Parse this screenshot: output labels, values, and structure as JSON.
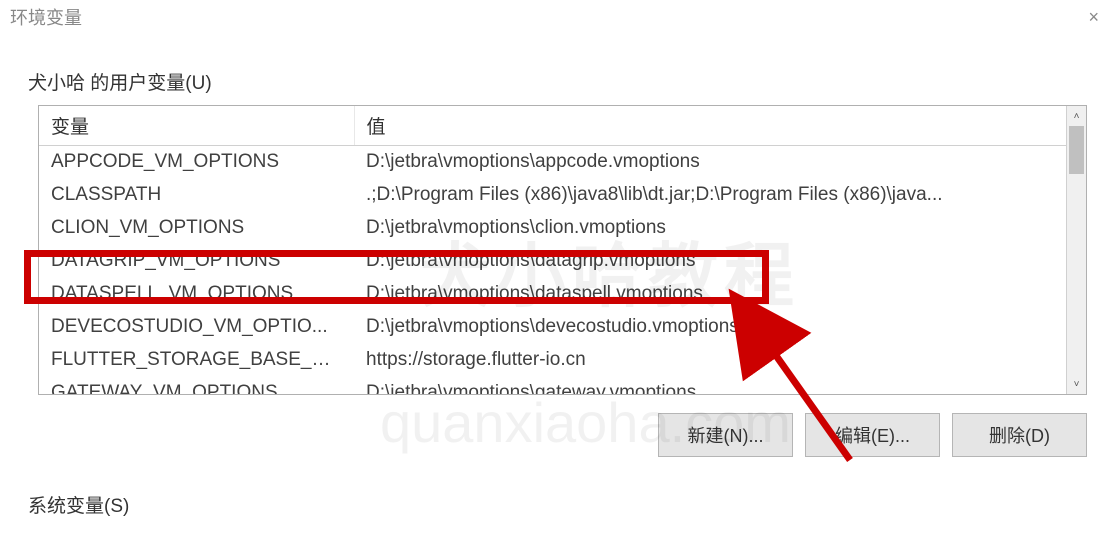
{
  "window": {
    "title": "环境变量",
    "close_label": "×"
  },
  "user_section": {
    "label": "犬小哈 的用户变量(U)"
  },
  "table": {
    "headers": {
      "variable": "变量",
      "value": "值"
    },
    "rows": [
      {
        "variable": "APPCODE_VM_OPTIONS",
        "value": "D:\\jetbra\\vmoptions\\appcode.vmoptions"
      },
      {
        "variable": "CLASSPATH",
        "value": ".;D:\\Program Files (x86)\\java8\\lib\\dt.jar;D:\\Program Files (x86)\\java..."
      },
      {
        "variable": "CLION_VM_OPTIONS",
        "value": "D:\\jetbra\\vmoptions\\clion.vmoptions"
      },
      {
        "variable": "DATAGRIP_VM_OPTIONS",
        "value": "D:\\jetbra\\vmoptions\\datagrip.vmoptions"
      },
      {
        "variable": "DATASPELL_VM_OPTIONS",
        "value": "D:\\jetbra\\vmoptions\\dataspell.vmoptions"
      },
      {
        "variable": "DEVECOSTUDIO_VM_OPTIO...",
        "value": "D:\\jetbra\\vmoptions\\devecostudio.vmoptions"
      },
      {
        "variable": "FLUTTER_STORAGE_BASE_URL",
        "value": "https://storage.flutter-io.cn"
      },
      {
        "variable": "GATEWAY_VM_OPTIONS",
        "value": "D:\\jetbra\\vmoptions\\gateway.vmoptions"
      }
    ]
  },
  "buttons": {
    "new_label": "新建(N)...",
    "edit_label": "编辑(E)...",
    "delete_label": "删除(D)"
  },
  "system_section": {
    "label": "系统变量(S)"
  },
  "watermarks": {
    "top": "犬小哈教程",
    "bottom": "quanxiaoha.com"
  }
}
